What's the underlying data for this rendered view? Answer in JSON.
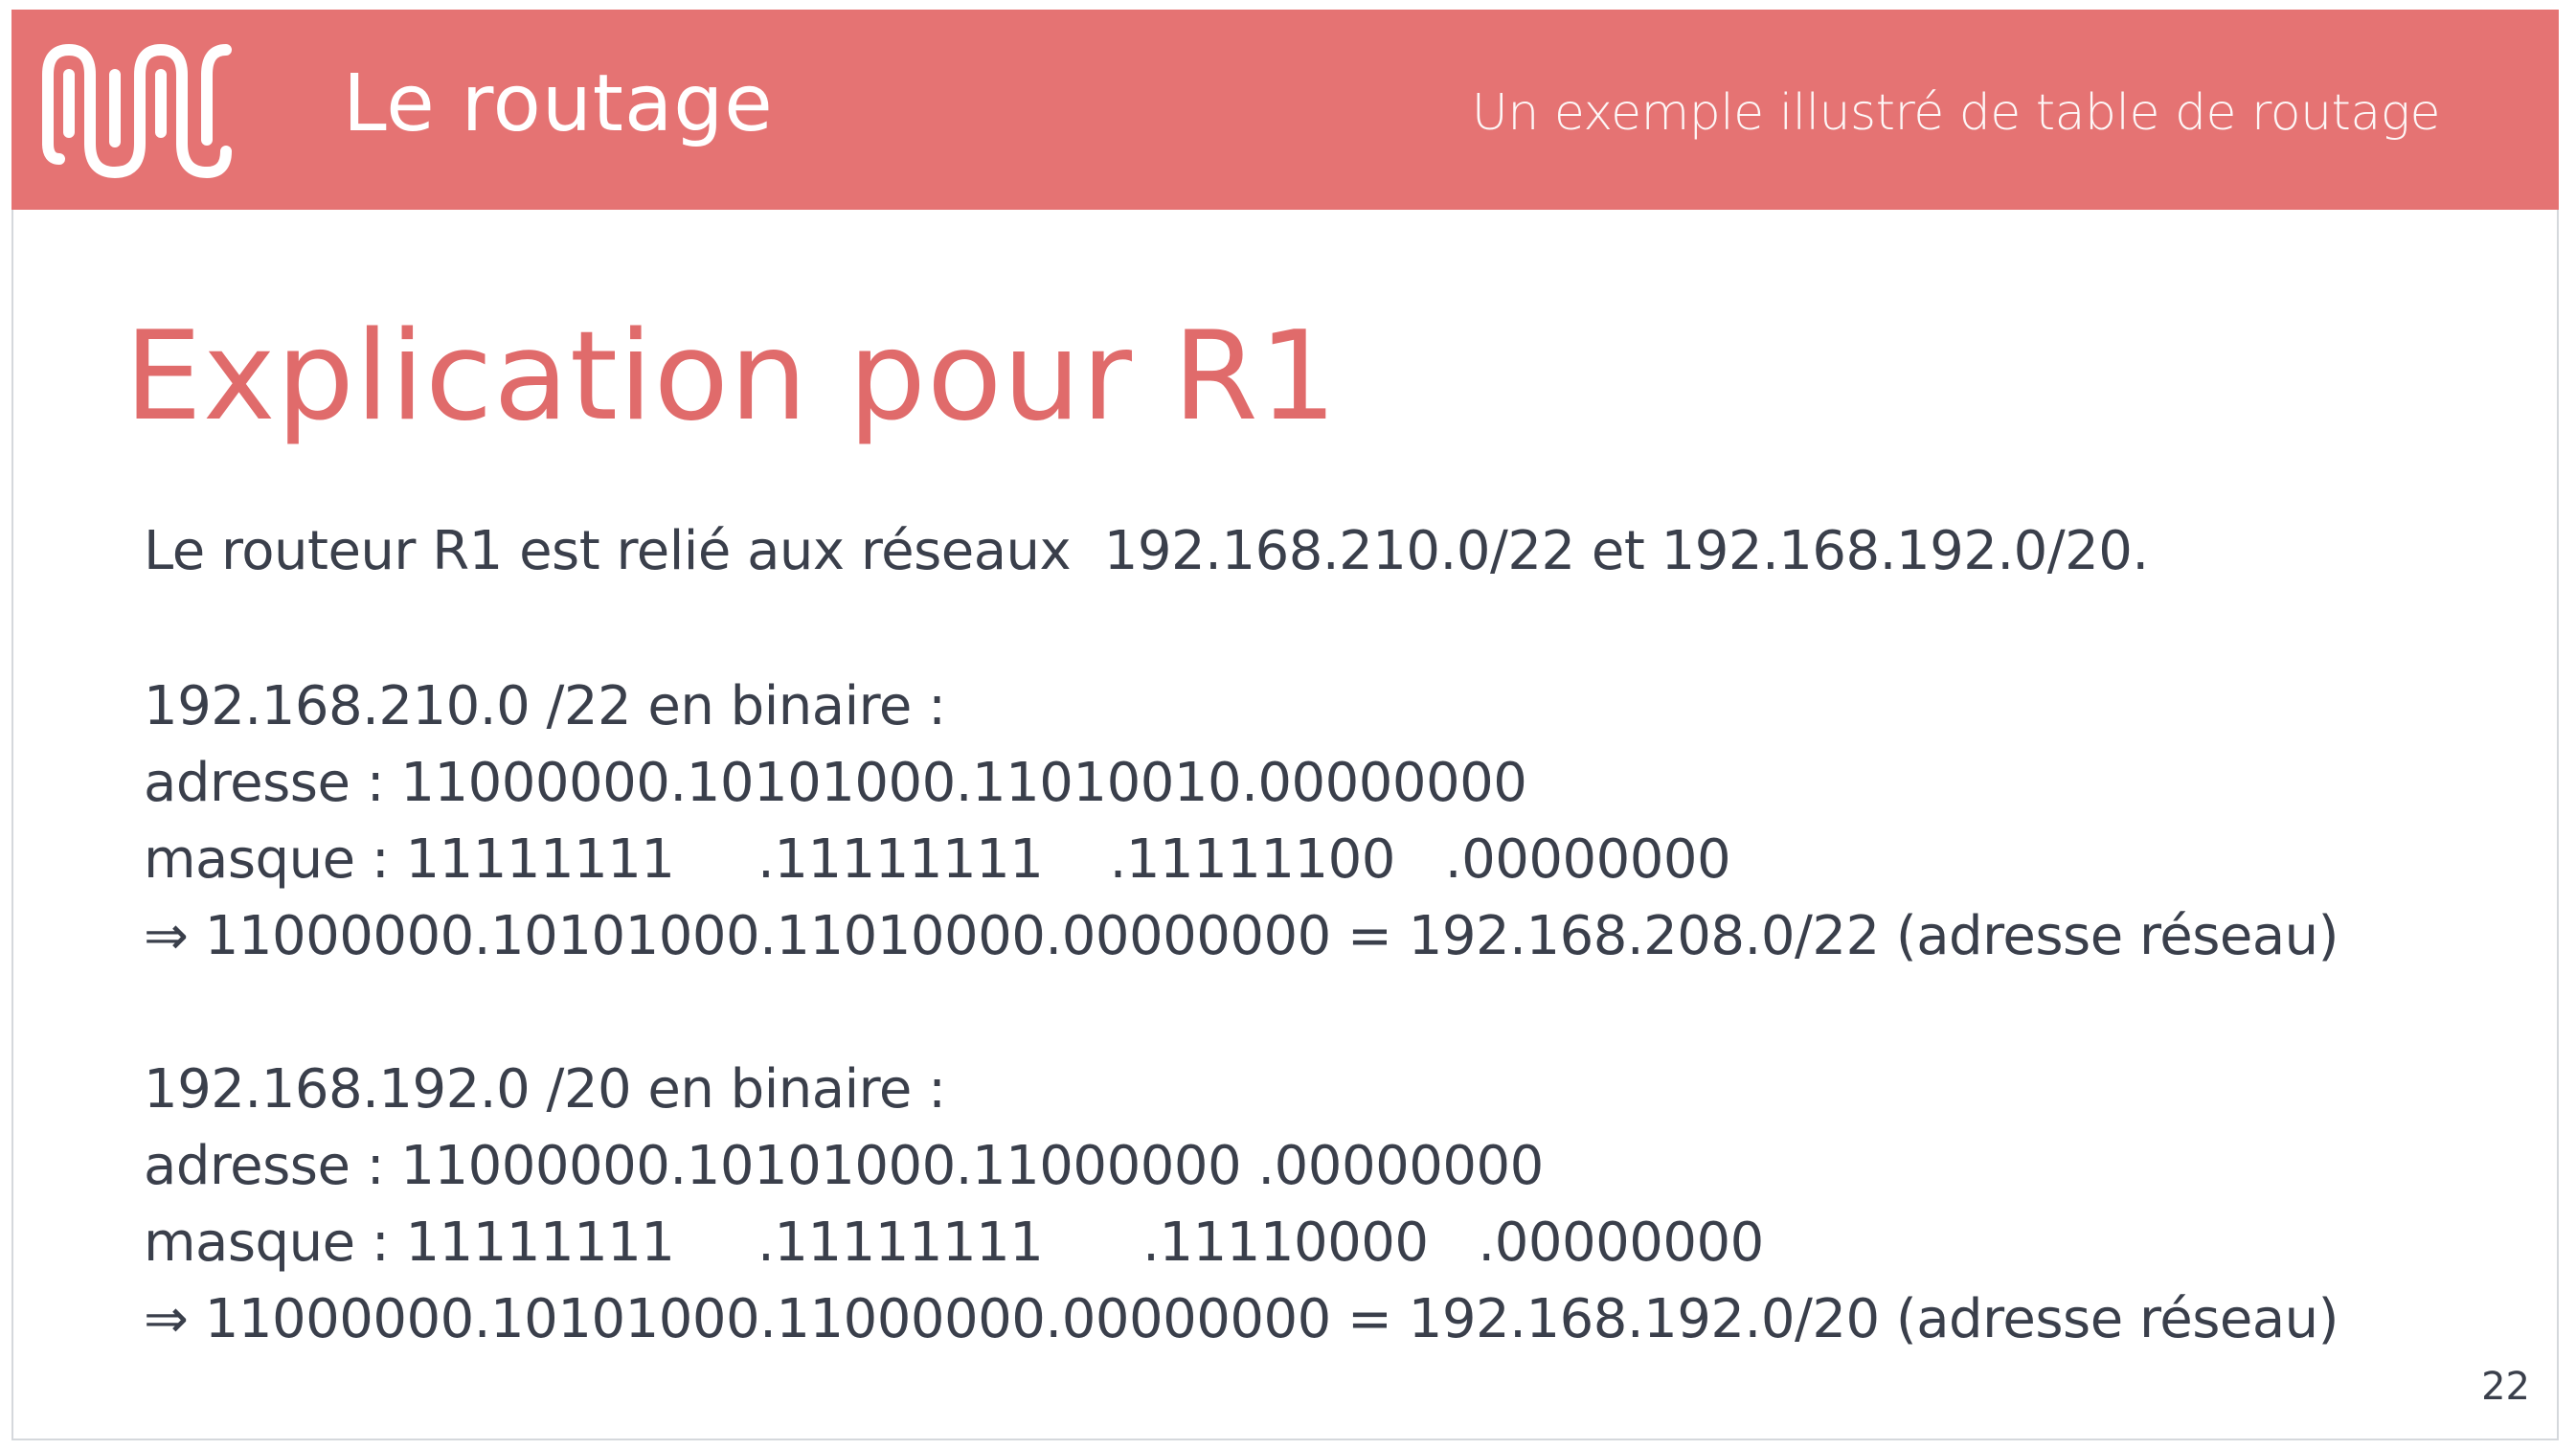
{
  "header": {
    "logo_icon": "wave-logo-icon",
    "title": "Le routage",
    "subtitle": "Un exemple illustré de table de routage"
  },
  "slide": {
    "title": "Explication pour R1",
    "lines": [
      "Le routeur R1 est relié aux réseaux  192.168.210.0/22 et 192.168.192.0/20.",
      "192.168.210.0 /22 en binaire :",
      "adresse : 11000000.10101000.11010010.00000000",
      "masque : 11111111     .11111111    .11111100   .00000000",
      "⇒ 11000000.10101000.11010000.00000000 = 192.168.208.0/22 (adresse réseau)",
      "192.168.192.0 /20 en binaire :",
      "adresse : 11000000.10101000.11000000 .00000000",
      "masque : 11111111     .11111111      .11110000   .00000000",
      "⇒ 11000000.10101000.11000000.00000000 = 192.168.192.0/20 (adresse réseau)"
    ],
    "page_number": "22"
  },
  "colors": {
    "accent": "#e57373",
    "title": "#e06b6b",
    "text": "#3a3f4b"
  }
}
